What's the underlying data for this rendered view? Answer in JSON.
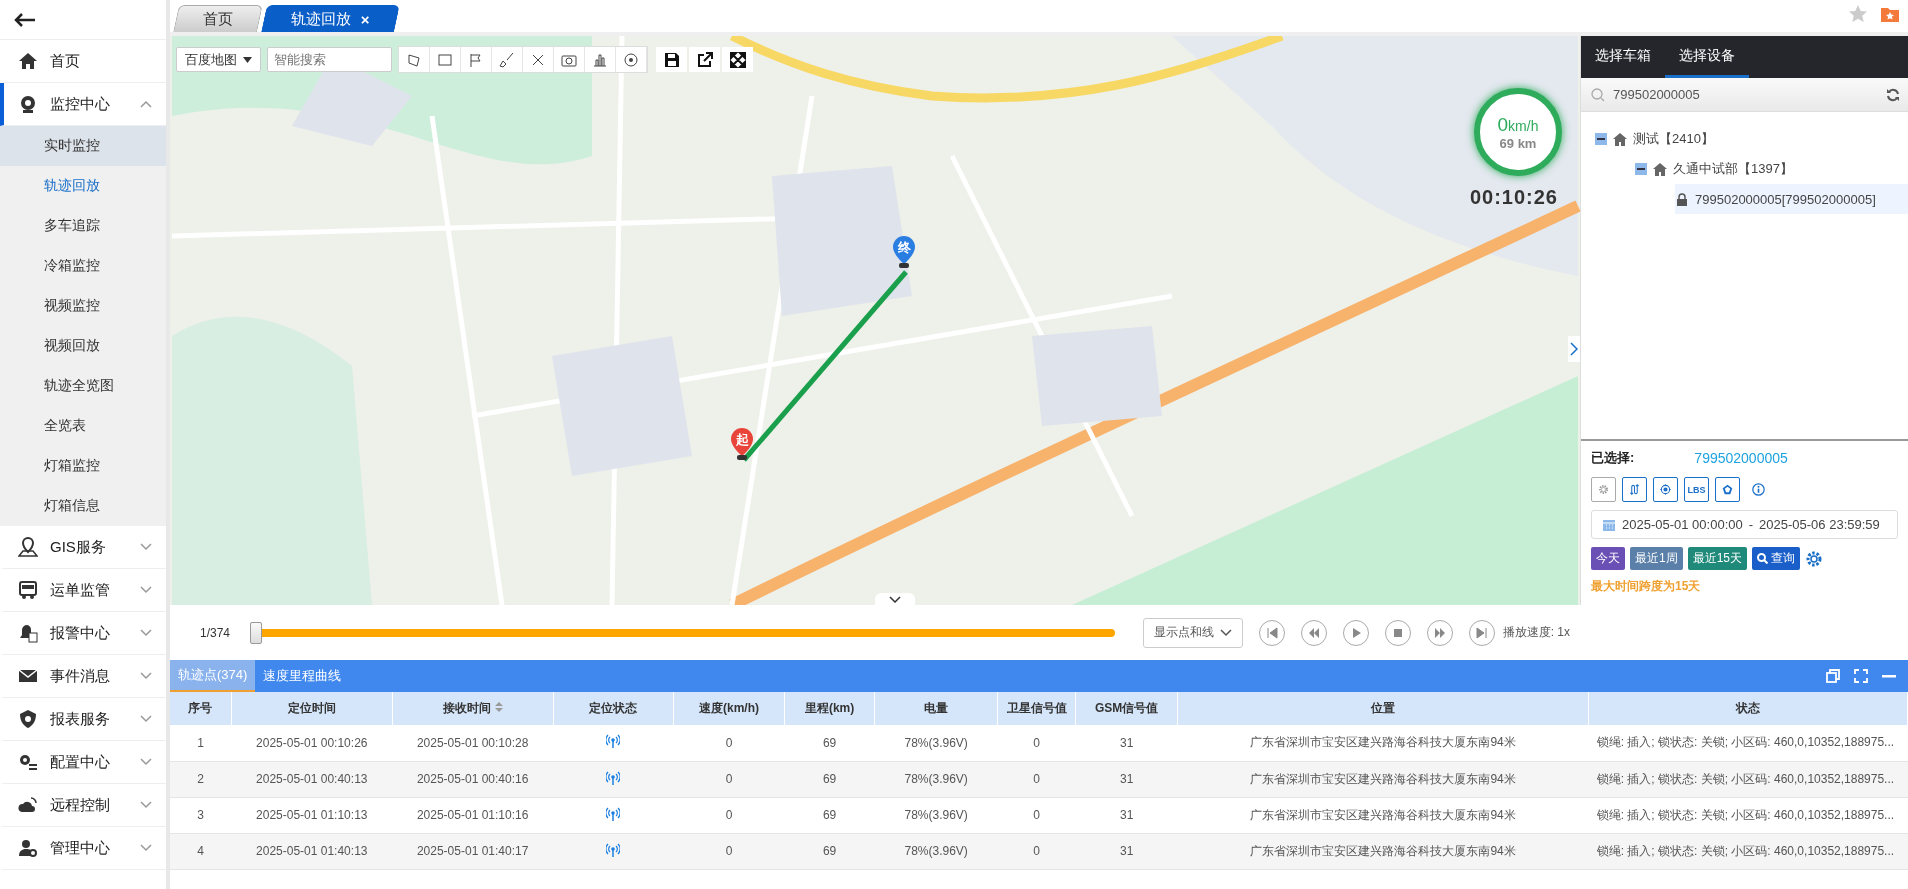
{
  "sidebar": {
    "items": [
      {
        "label": "首页",
        "active": false
      },
      {
        "label": "监控中心",
        "active": true,
        "expanded": true,
        "children": [
          {
            "label": "实时监控",
            "selected": false,
            "hovered": true
          },
          {
            "label": "轨迹回放",
            "selected": true,
            "hovered": false
          },
          {
            "label": "多车追踪",
            "selected": false,
            "hovered": false
          },
          {
            "label": "冷箱监控",
            "selected": false,
            "hovered": false
          },
          {
            "label": "视频监控",
            "selected": false,
            "hovered": false
          },
          {
            "label": "视频回放",
            "selected": false,
            "hovered": false
          },
          {
            "label": "轨迹全览图",
            "selected": false,
            "hovered": false
          },
          {
            "label": "全览表",
            "selected": false,
            "hovered": false
          },
          {
            "label": "灯箱监控",
            "selected": false,
            "hovered": false
          },
          {
            "label": "灯箱信息",
            "selected": false,
            "hovered": false
          }
        ]
      },
      {
        "label": "GIS服务",
        "active": false,
        "expanded": false
      },
      {
        "label": "运单监管",
        "active": false,
        "expanded": false
      },
      {
        "label": "报警中心",
        "active": false,
        "expanded": false
      },
      {
        "label": "事件消息",
        "active": false,
        "expanded": false
      },
      {
        "label": "报表服务",
        "active": false,
        "expanded": false
      },
      {
        "label": "配置中心",
        "active": false,
        "expanded": false
      },
      {
        "label": "远程控制",
        "active": false,
        "expanded": false
      },
      {
        "label": "管理中心",
        "active": false,
        "expanded": false
      }
    ]
  },
  "tabs": [
    {
      "label": "首页",
      "selected": false,
      "closable": false
    },
    {
      "label": "轨迹回放",
      "selected": true,
      "closable": true,
      "close": "×"
    }
  ],
  "map": {
    "layer_select": "百度地图",
    "search": {
      "placeholder": "智能搜索"
    },
    "start_marker": "起",
    "end_marker": "终",
    "speed": {
      "value": "0",
      "unit": "km/h",
      "mileage": "69 km"
    },
    "time": "00:10:26"
  },
  "playback": {
    "position": "1/374",
    "level": 0,
    "mode": "显示点和线",
    "speed": "播放速度: 1x"
  },
  "right_panel": {
    "tabs": [
      {
        "label": "选择车箱",
        "selected": false
      },
      {
        "label": "选择设备",
        "selected": true
      }
    ],
    "search": {
      "value": "799502000005"
    },
    "tree": [
      {
        "label": "测试【2410】",
        "kind": "group",
        "expanded": true,
        "children": [
          {
            "label": "久通中试部【1397】",
            "kind": "group",
            "expanded": true,
            "children": [
              {
                "label": "799502000005[799502000005]",
                "kind": "device",
                "selected": true
              }
            ]
          }
        ]
      }
    ],
    "selected_label": "已选择:",
    "selected_value": "799502000005",
    "tools": [
      {
        "kind": "gear",
        "disabled": true
      },
      {
        "kind": "route",
        "disabled": false
      },
      {
        "kind": "locate",
        "disabled": false
      },
      {
        "kind": "lbs",
        "label": "LBS",
        "disabled": false
      },
      {
        "kind": "fence",
        "disabled": false
      },
      {
        "kind": "info",
        "disabled": false
      }
    ],
    "date_range": {
      "start": "2025-05-01 00:00:00",
      "separator": "-",
      "end": "2025-05-06 23:59:59"
    },
    "quick_buttons": [
      {
        "label": "今天",
        "color": "#6a4fb5",
        "kind": "plain"
      },
      {
        "label": "最近1周",
        "color": "#5a7fa8",
        "kind": "plain"
      },
      {
        "label": "最近15天",
        "color": "#1f8a7a",
        "kind": "plain"
      },
      {
        "label": "查询",
        "color": "#1a5fc9",
        "kind": "search"
      }
    ],
    "hint": "最大时间跨度为15天"
  },
  "table": {
    "tabs": [
      {
        "label": "轨迹点(374)",
        "selected": true
      },
      {
        "label": "速度里程曲线",
        "selected": false
      }
    ],
    "columns": [
      {
        "label": "序号"
      },
      {
        "label": "定位时间"
      },
      {
        "label": "接收时间",
        "sortable": true
      },
      {
        "label": "定位状态",
        "kind": "icon"
      },
      {
        "label": "速度(km/h)"
      },
      {
        "label": "里程(km)"
      },
      {
        "label": "电量"
      },
      {
        "label": "卫星信号值"
      },
      {
        "label": "GSM信号值"
      },
      {
        "label": "位置"
      },
      {
        "label": "状态"
      }
    ],
    "rows": [
      {
        "positioned": true,
        "cells": [
          "1",
          "2025-05-01 00:10:26",
          "2025-05-01 00:10:28",
          "",
          "0",
          "69",
          "78%(3.96V)",
          "0",
          "31",
          "广东省深圳市宝安区建兴路海谷科技大厦东南94米",
          "锁绳: 插入; 锁状态: 关锁; 小区码: 460,0,10352,188975..."
        ]
      },
      {
        "positioned": true,
        "cells": [
          "2",
          "2025-05-01 00:40:13",
          "2025-05-01 00:40:16",
          "",
          "0",
          "69",
          "78%(3.96V)",
          "0",
          "31",
          "广东省深圳市宝安区建兴路海谷科技大厦东南94米",
          "锁绳: 插入; 锁状态: 关锁; 小区码: 460,0,10352,188975..."
        ]
      },
      {
        "positioned": true,
        "cells": [
          "3",
          "2025-05-01 01:10:13",
          "2025-05-01 01:10:16",
          "",
          "0",
          "69",
          "78%(3.96V)",
          "0",
          "31",
          "广东省深圳市宝安区建兴路海谷科技大厦东南94米",
          "锁绳: 插入; 锁状态: 关锁; 小区码: 460,0,10352,188975..."
        ]
      },
      {
        "positioned": true,
        "cells": [
          "4",
          "2025-05-01 01:40:13",
          "2025-05-01 01:40:17",
          "",
          "0",
          "69",
          "78%(3.96V)",
          "0",
          "31",
          "广东省深圳市宝安区建兴路海谷科技大厦东南94米",
          "锁绳: 插入; 锁状态: 关锁; 小区码: 460,0,10352,188975..."
        ]
      }
    ]
  }
}
